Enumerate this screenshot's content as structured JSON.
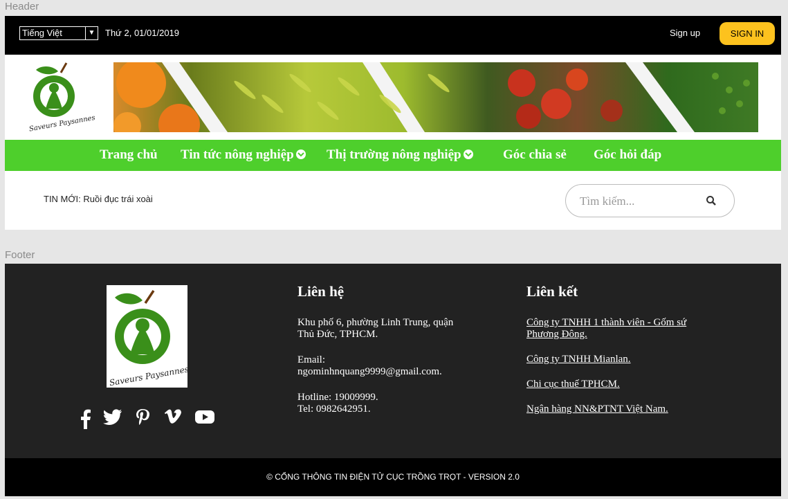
{
  "labels": {
    "header": "Header",
    "footer": "Footer"
  },
  "topbar": {
    "language": "Tiếng Việt",
    "language_caret": "▼",
    "date": "Thứ 2, 01/01/2019",
    "signup": "Sign up",
    "signin": "SIGN IN",
    "signin_color": "#fdc21e"
  },
  "logo": {
    "text": "Saveurs Paysannes"
  },
  "nav": {
    "color": "#4ecf2c",
    "items": [
      {
        "label": "Trang chủ"
      },
      {
        "label": "Tin tức nông nghiệp"
      },
      {
        "label": "Thị trường nông nghiệp"
      },
      {
        "label": "Góc chia sẻ"
      },
      {
        "label": "Góc hỏi đáp"
      }
    ]
  },
  "news": {
    "label": "TIN MỚI: Ruồi đục trái xoài"
  },
  "search": {
    "placeholder": "Tìm kiếm..."
  },
  "footer": {
    "contact": {
      "title": "Liên hệ",
      "address": "Khu phố 6, phường Linh Trung, quận Thủ Đức, TPHCM.",
      "email_label": "Email:",
      "email": "ngominhnquang9999@gmail.com.",
      "hotline": "Hotline: 19009999.",
      "tel": "Tel: 0982642951."
    },
    "links": {
      "title": "Liên kết",
      "items": [
        "Công ty TNHH 1 thành viên - Gốm sứ Phương Đông.",
        "Công ty TNHH Mianlan.",
        "Chi cục thuế TPHCM.",
        "Ngân hàng NN&PTNT Việt Nam."
      ]
    },
    "socials": [
      "facebook-icon",
      "twitter-icon",
      "pinterest-icon",
      "vimeo-icon",
      "youtube-icon"
    ],
    "copyright": "© CỔNG THÔNG TIN ĐIỆN TỬ CỤC TRỒNG TRỌT - VERSION 2.0"
  }
}
